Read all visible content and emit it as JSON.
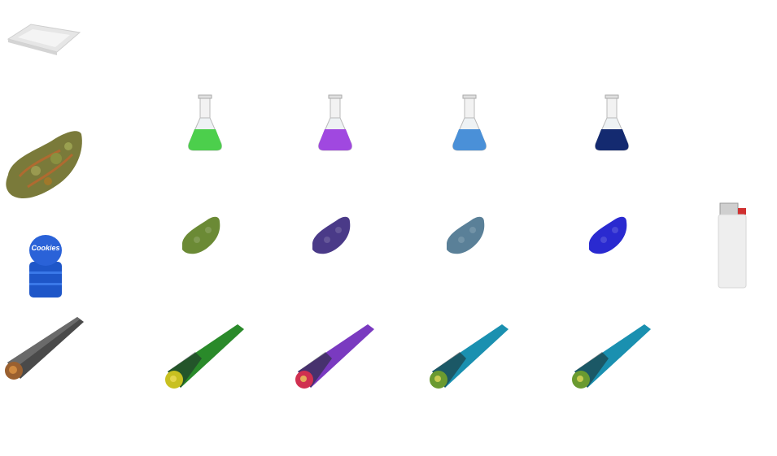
{
  "items": {
    "rolling_papers": {
      "icon": "rolling-papers-icon",
      "color": "#e8e8e8"
    },
    "bud_natural": {
      "icon": "cannabis-bud-icon",
      "color": "#7a7a3a"
    },
    "grinder": {
      "icon": "grinder-icon",
      "label": "Cookies",
      "color": "#1e56c8"
    },
    "lighter": {
      "icon": "lighter-icon",
      "color": "#f0f0f0",
      "accent": "#d03030"
    },
    "joint_plain": {
      "icon": "joint-icon",
      "color": "#444444"
    }
  },
  "strains": [
    {
      "name": "green",
      "flask_color": "#4ccf4c",
      "bud_color": "#6b8a35",
      "joint_color": "#2a8a2a",
      "tip_color": "#c8c020"
    },
    {
      "name": "purple",
      "flask_color": "#a048e0",
      "bud_color": "#4a3a88",
      "joint_color": "#7a3ac0",
      "tip_color": "#d03050"
    },
    {
      "name": "blue",
      "flask_color": "#4a90d8",
      "bud_color": "#5a8098",
      "joint_color": "#1a90b0",
      "tip_color": "#6a9a30"
    },
    {
      "name": "navy",
      "flask_color": "#142a70",
      "bud_color": "#2a2ad0",
      "joint_color": "#1a90b0",
      "tip_color": "#6a9a30"
    }
  ]
}
